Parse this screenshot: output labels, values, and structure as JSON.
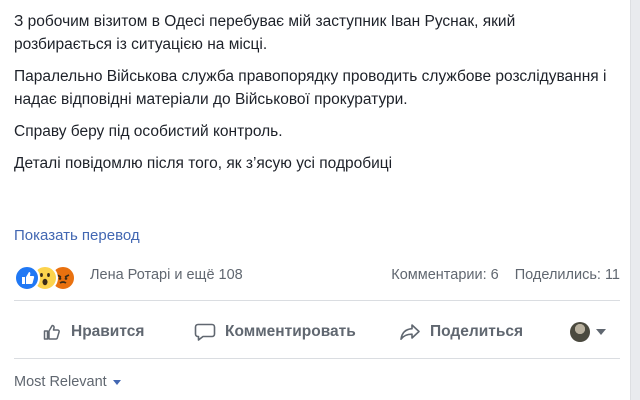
{
  "post": {
    "paragraphs": [
      "З робочим візитом в Одесі перебуває мій заступник Іван Руснак, який розбирається із ситуацією на місці.",
      "Паралельно Військова служба правопорядку проводить службове розслідування і надає відповідні матеріали до Військової прокуратури.",
      "Справу беру під особистий контроль.",
      "Деталі повідомлю після того, як з’ясую усі подробиці"
    ],
    "translate_link": "Показать перевод"
  },
  "reactions": {
    "icons": [
      "like-icon",
      "wow-icon",
      "angry-icon"
    ],
    "names_text": "Лена Ротарі и ещё 108",
    "comments_text": "Комментарии: 6",
    "shares_text": "Поделились: 11"
  },
  "actions": {
    "like_label": "Нравится",
    "comment_label": "Комментировать",
    "share_label": "Поделиться"
  },
  "comments_sort": {
    "label": "Most Relevant"
  },
  "colors": {
    "link": "#4267b2",
    "secondary_text": "#606770",
    "body_text": "#1d2129",
    "like_blue": "#2078f4",
    "angry_orange": "#e9710f"
  }
}
